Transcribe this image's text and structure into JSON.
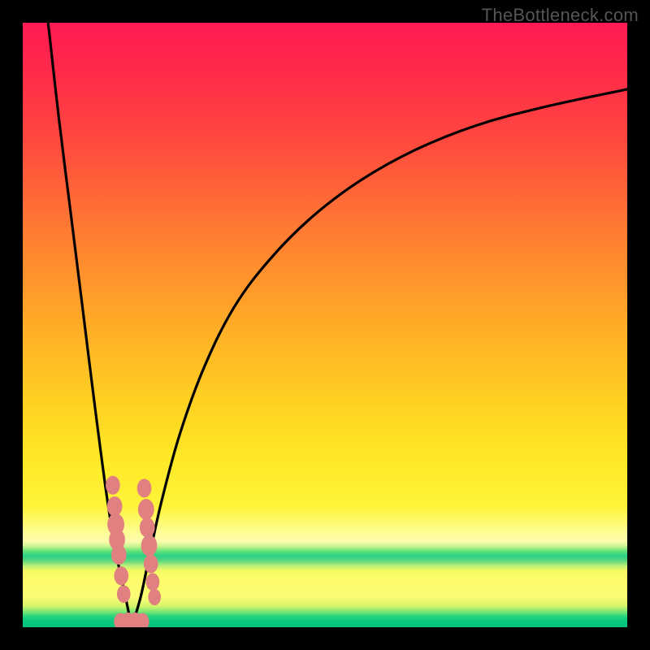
{
  "watermark": "TheBottleneck.com",
  "colors": {
    "gradient_top": "#ff1a53",
    "gradient_mid": "#ffe826",
    "gradient_bottom": "#00c37a",
    "curve": "#000000",
    "dots": "#e08080",
    "frame": "#000000"
  },
  "chart_data": {
    "type": "line",
    "title": "",
    "xlabel": "",
    "ylabel": "",
    "xlim": [
      0,
      100
    ],
    "ylim": [
      0,
      100
    ],
    "x_at_min": 18,
    "series": [
      {
        "name": "left-branch",
        "x": [
          4.2,
          6,
          8,
          10,
          12,
          14,
          15.5,
          17,
          18
        ],
        "y": [
          100,
          84,
          68,
          52,
          36,
          21,
          12,
          5,
          0
        ]
      },
      {
        "name": "right-branch",
        "x": [
          18,
          19.5,
          21,
          23,
          26,
          30,
          35,
          41,
          48,
          56,
          65,
          75,
          86,
          100
        ],
        "y": [
          0,
          5,
          12,
          21,
          32,
          43,
          53,
          61,
          68,
          74,
          79,
          83,
          86,
          89
        ]
      }
    ],
    "scatter": {
      "name": "highlight-dots",
      "points": [
        {
          "x": 14.9,
          "y": 23.5,
          "r": 1.7
        },
        {
          "x": 15.2,
          "y": 20.0,
          "r": 1.8
        },
        {
          "x": 15.4,
          "y": 17.0,
          "r": 2.0
        },
        {
          "x": 15.6,
          "y": 14.5,
          "r": 1.9
        },
        {
          "x": 15.9,
          "y": 12.0,
          "r": 1.8
        },
        {
          "x": 16.3,
          "y": 8.5,
          "r": 1.7
        },
        {
          "x": 16.7,
          "y": 5.5,
          "r": 1.6
        },
        {
          "x": 20.1,
          "y": 23.0,
          "r": 1.7
        },
        {
          "x": 20.4,
          "y": 19.5,
          "r": 1.9
        },
        {
          "x": 20.6,
          "y": 16.5,
          "r": 1.8
        },
        {
          "x": 20.9,
          "y": 13.5,
          "r": 1.9
        },
        {
          "x": 21.2,
          "y": 10.5,
          "r": 1.7
        },
        {
          "x": 21.5,
          "y": 7.5,
          "r": 1.6
        },
        {
          "x": 21.8,
          "y": 5.0,
          "r": 1.5
        },
        {
          "x": 16.2,
          "y": 0.9,
          "r": 1.6
        },
        {
          "x": 17.4,
          "y": 0.9,
          "r": 1.7
        },
        {
          "x": 18.6,
          "y": 0.9,
          "r": 1.7
        },
        {
          "x": 19.8,
          "y": 0.9,
          "r": 1.6
        }
      ]
    }
  }
}
